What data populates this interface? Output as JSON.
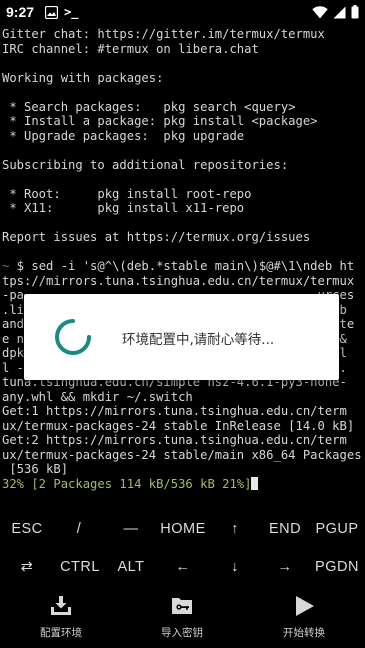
{
  "status_bar": {
    "time": "9:27",
    "terminal_symbol": ">_"
  },
  "terminal": {
    "lines": [
      {
        "text": "Gitter chat: https://gitter.im/termux/termux",
        "style": ""
      },
      {
        "text": "IRC channel: #termux on libera.chat",
        "style": ""
      },
      {
        "text": "",
        "style": ""
      },
      {
        "text": "Working with packages:",
        "style": ""
      },
      {
        "text": "",
        "style": ""
      },
      {
        "text": " * Search packages:   pkg search <query>",
        "style": ""
      },
      {
        "text": " * Install a package: pkg install <package>",
        "style": ""
      },
      {
        "text": " * Upgrade packages:  pkg upgrade",
        "style": ""
      },
      {
        "text": "",
        "style": ""
      },
      {
        "text": "Subscribing to additional repositories:",
        "style": ""
      },
      {
        "text": "",
        "style": ""
      },
      {
        "text": " * Root:     pkg install root-repo",
        "style": ""
      },
      {
        "text": " * X11:      pkg install x11-repo",
        "style": ""
      },
      {
        "text": "",
        "style": ""
      },
      {
        "text": "Report issues at https://termux.org/issues",
        "style": ""
      },
      {
        "text": "",
        "style": ""
      },
      {
        "text": "~ $ sed -i 's@^\\(deb.*stable main\\)$@#\\1\\ndeb ht",
        "style": "prompt"
      },
      {
        "text": "tps://mirrors.tuna.tsinghua.edu.cn/termux/termux",
        "style": ""
      },
      {
        "text": "-pa                                        urces",
        "style": ""
      },
      {
        "text": ".li                                         lib",
        "style": ""
      },
      {
        "text": "and                                         lite",
        "style": ""
      },
      {
        "text": "e n                                        l &&",
        "style": ""
      },
      {
        "text": "dpk                                        stal",
        "style": ""
      },
      {
        "text": "l -y python pip && pip install -i https://pypi.",
        "style": ""
      },
      {
        "text": "tuna.tsinghua.edu.cn/simple nsz-4.6.1-py3-none-",
        "style": ""
      },
      {
        "text": "any.whl && mkdir ~/.switch",
        "style": ""
      },
      {
        "text": "Get:1 https://mirrors.tuna.tsinghua.edu.cn/term",
        "style": ""
      },
      {
        "text": "ux/termux-packages-24 stable InRelease [14.0 kB]",
        "style": ""
      },
      {
        "text": "Get:2 https://mirrors.tuna.tsinghua.edu.cn/term",
        "style": ""
      },
      {
        "text": "ux/termux-packages-24 stable/main x86_64 Packages",
        "style": ""
      },
      {
        "text": " [536 kB]",
        "style": ""
      },
      {
        "text": "32% [2 Packages 114 kB/536 kB 21%]",
        "style": "progress"
      }
    ]
  },
  "dialog": {
    "message": "环境配置中,请耐心等待..."
  },
  "extra_keys": {
    "row1": [
      "ESC",
      "/",
      "—",
      "HOME",
      "↑",
      "END",
      "PGUP"
    ],
    "row2": [
      "⇄",
      "CTRL",
      "ALT",
      "←",
      "↓",
      "→",
      "PGDN"
    ]
  },
  "bottom_nav": {
    "items": [
      {
        "label": "配置环境",
        "icon": "download-tray-icon"
      },
      {
        "label": "导入密钥",
        "icon": "key-folder-icon"
      },
      {
        "label": "开始转换",
        "icon": "play-icon"
      }
    ]
  },
  "colors": {
    "background": "#000000",
    "terminal_text": "#d6d6d6",
    "progress_text": "#9fbf5f",
    "spinner": "#1a8a82",
    "dialog_bg": "#ffffff"
  }
}
